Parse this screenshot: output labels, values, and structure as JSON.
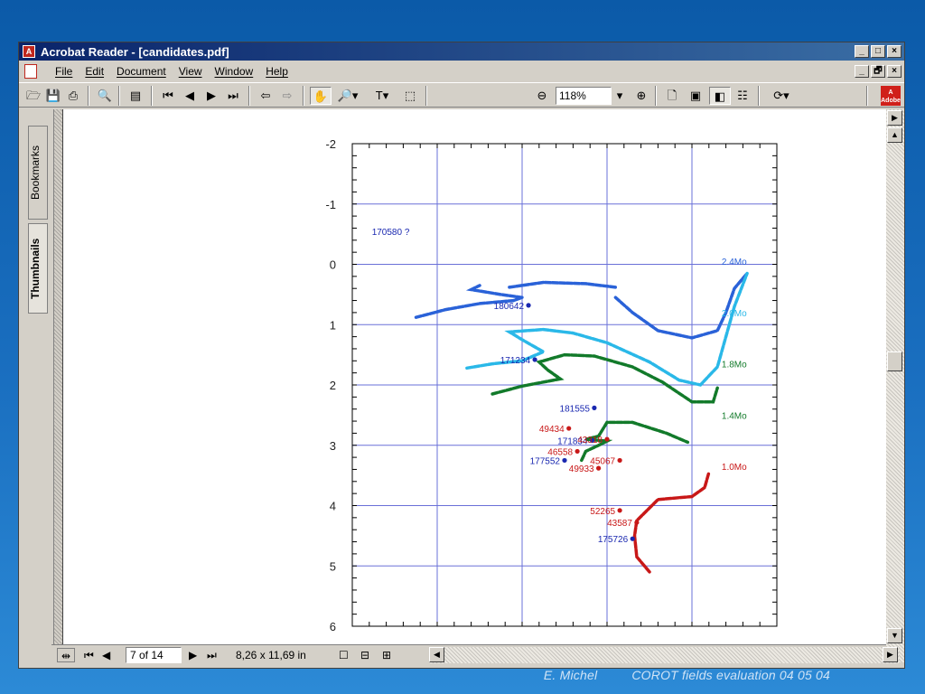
{
  "window": {
    "title": "Acrobat Reader - [candidates.pdf]",
    "window_buttons": [
      "_",
      "□",
      "×"
    ],
    "doc_buttons": [
      "_",
      "🗗",
      "×"
    ]
  },
  "menu": [
    "File",
    "Edit",
    "Document",
    "View",
    "Window",
    "Help"
  ],
  "toolbar": {
    "zoom": "118%",
    "icons": [
      "open-icon",
      "save-icon",
      "print-icon",
      "find-icon",
      "show-hide-navpane-icon",
      "first-page-icon",
      "prev-page-icon",
      "next-page-icon",
      "last-page-icon",
      "go-back-icon",
      "go-forward-icon",
      "hand-tool-icon",
      "zoom-tool-icon",
      "text-select-icon",
      "graphics-select-icon",
      "zoom-out-icon",
      "zoom-in-icon",
      "actual-size-icon",
      "fit-page-icon",
      "fit-width-icon",
      "reflow-icon",
      "rotate-icon",
      "adobe-online-icon"
    ]
  },
  "navpane": {
    "tabs": [
      "Bookmarks",
      "Thumbnails"
    ],
    "active": "Thumbnails"
  },
  "status": {
    "page": "7 of 14",
    "size": "8,26 x 11,69 in"
  },
  "footer": {
    "author": "E. Michel",
    "text": "COROT fields evaluation 04 05 04"
  },
  "colors": {
    "grid": "#6a70d8",
    "blue": "#2a62d8",
    "cyan": "#2ab8e8",
    "green": "#127a2a",
    "red": "#c81818",
    "navy": "#1a28b0"
  },
  "chart_data": {
    "type": "scatter",
    "y_tick_labels": [
      "-2",
      "-1",
      "0",
      "1",
      "2",
      "3",
      "4",
      "5",
      "6"
    ],
    "ylim": [
      -2,
      6
    ],
    "y_inverted": true,
    "x_ticks_labeled": false,
    "grid": true,
    "mass_labels": [
      {
        "text": "2.4Mo",
        "y": -0.05,
        "color": "blue"
      },
      {
        "text": "2.0Mo",
        "y": 0.8,
        "color": "cyan"
      },
      {
        "text": "1.8Mo",
        "y": 1.65,
        "color": "green"
      },
      {
        "text": "1.4Mo",
        "y": 2.5,
        "color": "green"
      },
      {
        "text": "1.0Mo",
        "y": 3.35,
        "color": "red"
      }
    ],
    "stars": [
      {
        "id": "170580 ?",
        "x": 0.11,
        "y": -0.55,
        "color": "navy",
        "marker": false
      },
      {
        "id": "180642",
        "x": 0.415,
        "y": 0.68,
        "color": "navy"
      },
      {
        "id": "171234",
        "x": 0.43,
        "y": 1.58,
        "color": "navy"
      },
      {
        "id": "181555",
        "x": 0.57,
        "y": 2.38,
        "color": "navy"
      },
      {
        "id": "49434",
        "x": 0.51,
        "y": 2.72,
        "color": "red"
      },
      {
        "id": "171834",
        "x": 0.565,
        "y": 2.92,
        "color": "navy"
      },
      {
        "id": "43318",
        "x": 0.6,
        "y": 2.9,
        "color": "red"
      },
      {
        "id": "46558",
        "x": 0.53,
        "y": 3.1,
        "color": "red"
      },
      {
        "id": "177552",
        "x": 0.5,
        "y": 3.25,
        "color": "navy"
      },
      {
        "id": "45067",
        "x": 0.63,
        "y": 3.25,
        "color": "red"
      },
      {
        "id": "49933",
        "x": 0.58,
        "y": 3.38,
        "color": "red"
      },
      {
        "id": "52265",
        "x": 0.63,
        "y": 4.08,
        "color": "red"
      },
      {
        "id": "43587",
        "x": 0.67,
        "y": 4.28,
        "color": "red"
      },
      {
        "id": "175726",
        "x": 0.66,
        "y": 4.55,
        "color": "navy"
      }
    ],
    "tracks": [
      {
        "name": "",
        "color": "blue",
        "points": [
          [
            0.37,
            0.38
          ],
          [
            0.45,
            0.3
          ],
          [
            0.55,
            0.32
          ],
          [
            0.62,
            0.38
          ]
        ]
      },
      {
        "name": "",
        "color": "blue",
        "points": [
          [
            0.15,
            0.88
          ],
          [
            0.22,
            0.75
          ],
          [
            0.3,
            0.65
          ],
          [
            0.38,
            0.6
          ],
          [
            0.4,
            0.55
          ],
          [
            0.35,
            0.5
          ],
          [
            0.28,
            0.42
          ],
          [
            0.3,
            0.35
          ]
        ]
      },
      {
        "name": "",
        "color": "blue",
        "points": [
          [
            0.62,
            0.55
          ],
          [
            0.66,
            0.8
          ],
          [
            0.72,
            1.1
          ],
          [
            0.8,
            1.22
          ],
          [
            0.86,
            1.1
          ],
          [
            0.88,
            0.8
          ],
          [
            0.9,
            0.4
          ],
          [
            0.93,
            0.15
          ]
        ]
      },
      {
        "name": "",
        "color": "cyan",
        "points": [
          [
            0.27,
            1.72
          ],
          [
            0.33,
            1.65
          ],
          [
            0.4,
            1.6
          ],
          [
            0.45,
            1.45
          ],
          [
            0.4,
            1.25
          ],
          [
            0.37,
            1.12
          ],
          [
            0.45,
            1.08
          ],
          [
            0.52,
            1.14
          ],
          [
            0.6,
            1.3
          ],
          [
            0.7,
            1.62
          ],
          [
            0.77,
            1.92
          ],
          [
            0.82,
            2.0
          ],
          [
            0.86,
            1.7
          ],
          [
            0.88,
            1.2
          ],
          [
            0.9,
            0.7
          ],
          [
            0.93,
            0.15
          ]
        ]
      },
      {
        "name": "",
        "color": "green",
        "points": [
          [
            0.33,
            2.15
          ],
          [
            0.4,
            2.02
          ],
          [
            0.49,
            1.9
          ],
          [
            0.46,
            1.75
          ],
          [
            0.44,
            1.62
          ],
          [
            0.5,
            1.5
          ],
          [
            0.57,
            1.52
          ],
          [
            0.66,
            1.7
          ],
          [
            0.73,
            1.95
          ],
          [
            0.8,
            2.28
          ],
          [
            0.85,
            2.28
          ],
          [
            0.86,
            2.05
          ]
        ]
      },
      {
        "name": "",
        "color": "green",
        "points": [
          [
            0.54,
            3.25
          ],
          [
            0.55,
            3.1
          ],
          [
            0.58,
            3.0
          ],
          [
            0.6,
            2.93
          ],
          [
            0.55,
            2.9
          ],
          [
            0.58,
            2.85
          ],
          [
            0.6,
            2.62
          ],
          [
            0.66,
            2.62
          ],
          [
            0.74,
            2.8
          ],
          [
            0.79,
            2.95
          ]
        ]
      },
      {
        "name": "",
        "color": "red",
        "points": [
          [
            0.7,
            5.1
          ],
          [
            0.67,
            4.85
          ],
          [
            0.665,
            4.5
          ],
          [
            0.67,
            4.25
          ],
          [
            0.72,
            3.9
          ],
          [
            0.8,
            3.85
          ],
          [
            0.83,
            3.7
          ],
          [
            0.84,
            3.45
          ]
        ]
      }
    ]
  }
}
